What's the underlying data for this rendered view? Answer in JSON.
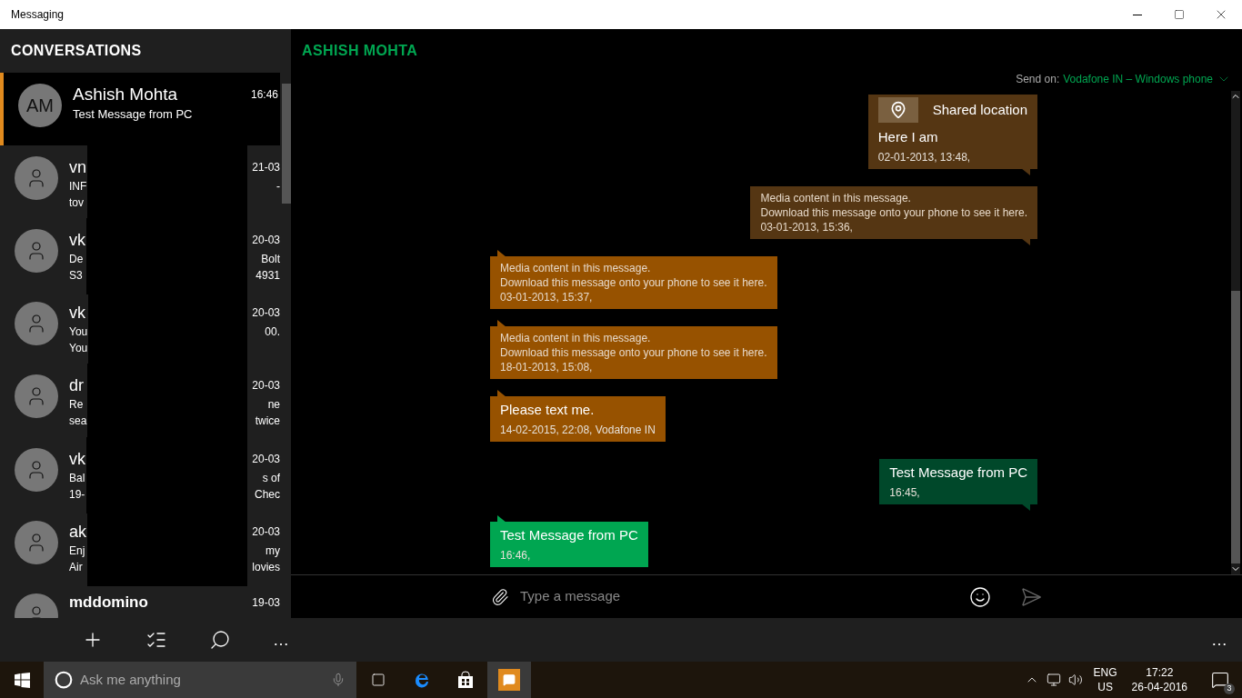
{
  "window": {
    "title": "Messaging"
  },
  "sidebar": {
    "title": "CONVERSATIONS",
    "conversations": [
      {
        "kind": "full",
        "initials": "AM",
        "name": "Ashish Mohta",
        "time": "16:46",
        "preview": "Test Message from PC",
        "selected": true
      },
      {
        "kind": "redacted",
        "name": "vn",
        "time": "21-03",
        "lines": [
          [
            "INF",
            "-"
          ],
          [
            "tov"
          ]
        ],
        "selected": false
      },
      {
        "kind": "redacted",
        "name": "vk",
        "time": "20-03",
        "lines": [
          [
            "De",
            "Bolt"
          ],
          [
            "S3",
            "4931"
          ]
        ],
        "selected": false
      },
      {
        "kind": "redacted",
        "name": "vk",
        "time": "20-03",
        "lines": [
          [
            "You",
            "00."
          ],
          [
            "You"
          ]
        ],
        "selected": false
      },
      {
        "kind": "redacted",
        "name": "dr",
        "time": "20-03",
        "lines": [
          [
            "Re",
            "ne"
          ],
          [
            "sea",
            "twice"
          ]
        ],
        "selected": false
      },
      {
        "kind": "redacted",
        "name": "vk",
        "time": "20-03",
        "lines": [
          [
            "Bal",
            "s of"
          ],
          [
            "19-",
            "Chec"
          ]
        ],
        "selected": false
      },
      {
        "kind": "redacted",
        "name": "ak",
        "time": "20-03",
        "lines": [
          [
            "Enj",
            "my"
          ],
          [
            "Air",
            "lovies"
          ]
        ],
        "selected": false
      },
      {
        "kind": "partial",
        "name": "mddomino",
        "time": "19-03",
        "selected": false
      }
    ]
  },
  "chat": {
    "contact": "ASHISH MOHTA",
    "send_on_label": "Send on:",
    "send_on_value": "Vodafone IN – Windows phone",
    "messages": [
      {
        "outgoing": true,
        "kind": "text",
        "color": "#553613",
        "attachment": "Shared location",
        "lines": [
          "Here I am"
        ],
        "meta": "02-01-2013, 13:48,"
      },
      {
        "outgoing": true,
        "kind": "media",
        "color": "#553613",
        "lines": [
          "Media content in this message.",
          "Download this message onto your phone to see it here."
        ],
        "meta": "03-01-2013, 15:36,"
      },
      {
        "outgoing": false,
        "kind": "media",
        "color": "#975200",
        "lines": [
          "Media content in this message.",
          "Download this message onto your phone to see it here."
        ],
        "meta": "03-01-2013, 15:37,"
      },
      {
        "outgoing": false,
        "kind": "media",
        "color": "#975200",
        "lines": [
          "Media content in this message.",
          "Download this message onto your phone to see it here."
        ],
        "meta": "18-01-2013, 15:08,"
      },
      {
        "outgoing": false,
        "kind": "text",
        "color": "#975200",
        "lines": [
          "Please text me."
        ],
        "meta": "14-02-2015, 22:08, Vodafone IN"
      },
      {
        "outgoing": true,
        "kind": "text",
        "color": "#00482a",
        "lines": [
          "Test Message from PC"
        ],
        "meta": "16:45,"
      },
      {
        "outgoing": false,
        "kind": "text",
        "color": "#00a651",
        "lines": [
          "Test Message from PC"
        ],
        "meta": "16:46,"
      }
    ],
    "input": {
      "placeholder": "Type a message"
    }
  },
  "app_bar": {
    "more": "…",
    "sidebar_more": "…"
  },
  "taskbar": {
    "search_placeholder": "Ask me anything",
    "language": "ENG",
    "region": "US",
    "time": "17:22",
    "date": "26-04-2016",
    "notifications": "3"
  }
}
